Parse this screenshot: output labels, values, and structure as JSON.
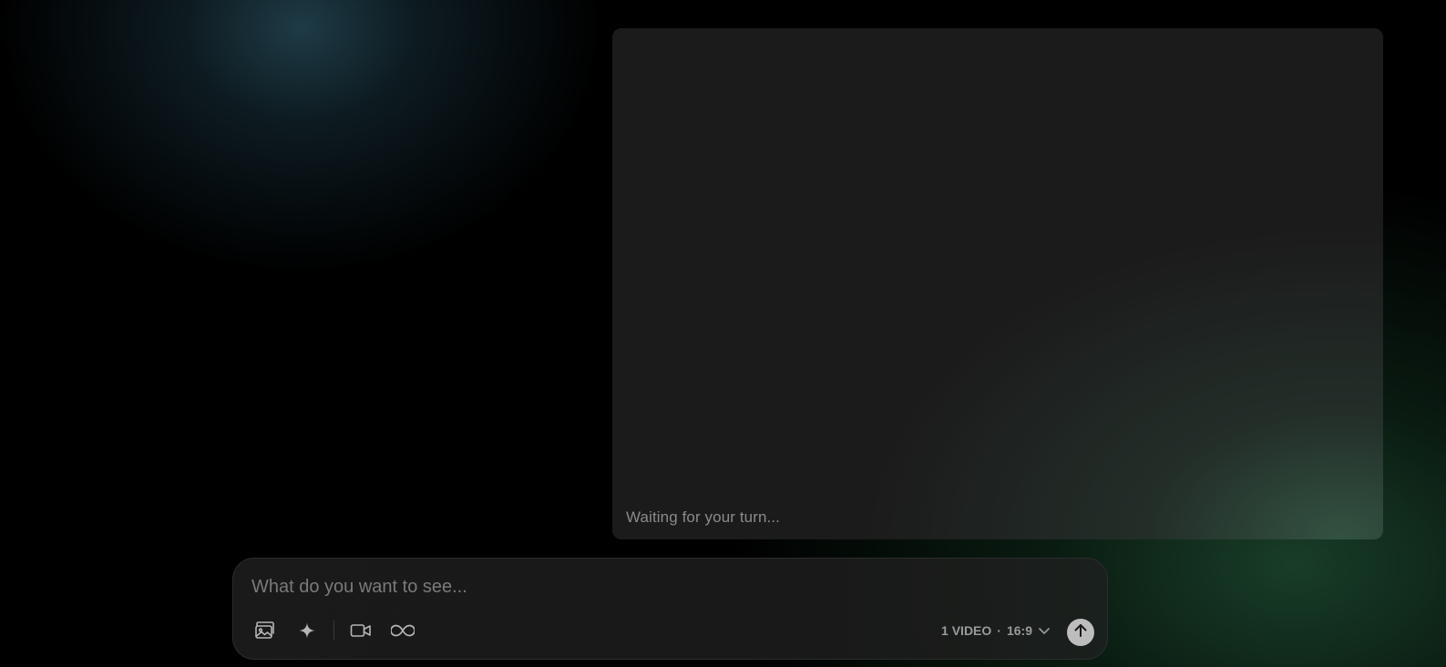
{
  "video_card": {
    "status_text": "Waiting for your turn..."
  },
  "composer": {
    "placeholder": "What do you want to see...",
    "value": "",
    "tools": [
      {
        "icon": "image-stack-icon"
      },
      {
        "icon": "sparkle-icon"
      },
      {
        "icon": "video-camera-icon"
      },
      {
        "icon": "infinity-icon"
      }
    ],
    "settings": {
      "count": "1 VIDEO",
      "separator": "·",
      "aspect_ratio": "16:9"
    },
    "send_icon": "arrow-up-icon"
  },
  "colors": {
    "background": "#000000",
    "card": "#1b1b1b",
    "composer": "#1a1a1a",
    "muted_text": "#8a8a8a",
    "send_button": "#bdbdbd",
    "teal_glow": "#203e4a",
    "green_glow": "#1a402a"
  }
}
